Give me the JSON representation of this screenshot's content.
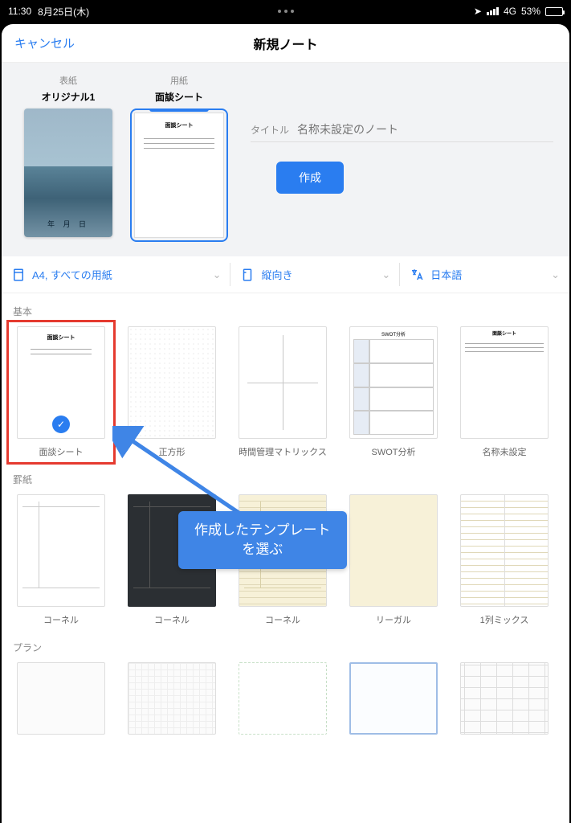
{
  "status": {
    "time": "11:30",
    "date": "8月25日(木)",
    "network": "4G",
    "battery_pct": "53%"
  },
  "nav": {
    "cancel": "キャンセル",
    "title": "新規ノート"
  },
  "hero": {
    "cover_label": "表紙",
    "cover_name": "オリジナル1",
    "cover_date": "年 月 日",
    "paper_label": "用紙",
    "paper_name": "面談シート",
    "paper_thumb_title": "面談シート",
    "title_label": "タイトル",
    "title_placeholder": "名称未設定のノート",
    "create": "作成"
  },
  "options": {
    "size": "A4, すべての用紙",
    "orientation": "縦向き",
    "language": "日本語"
  },
  "sections": {
    "basic": {
      "title": "基本",
      "items": [
        {
          "cap": "面談シート",
          "selected": true
        },
        {
          "cap": "正方形"
        },
        {
          "cap": "時間管理マトリックス"
        },
        {
          "cap": "SWOT分析",
          "thumb_title": "SWOT分析"
        },
        {
          "cap": "名称未設定",
          "thumb_title": "面談シート"
        }
      ]
    },
    "lined": {
      "title": "罫紙",
      "items": [
        {
          "cap": "コーネル"
        },
        {
          "cap": "コーネル"
        },
        {
          "cap": "コーネル"
        },
        {
          "cap": "リーガル"
        },
        {
          "cap": "1列ミックス"
        }
      ]
    },
    "plan": {
      "title": "プラン"
    }
  },
  "annotation": {
    "line1": "作成したテンプレート",
    "line2": "を選ぶ"
  }
}
